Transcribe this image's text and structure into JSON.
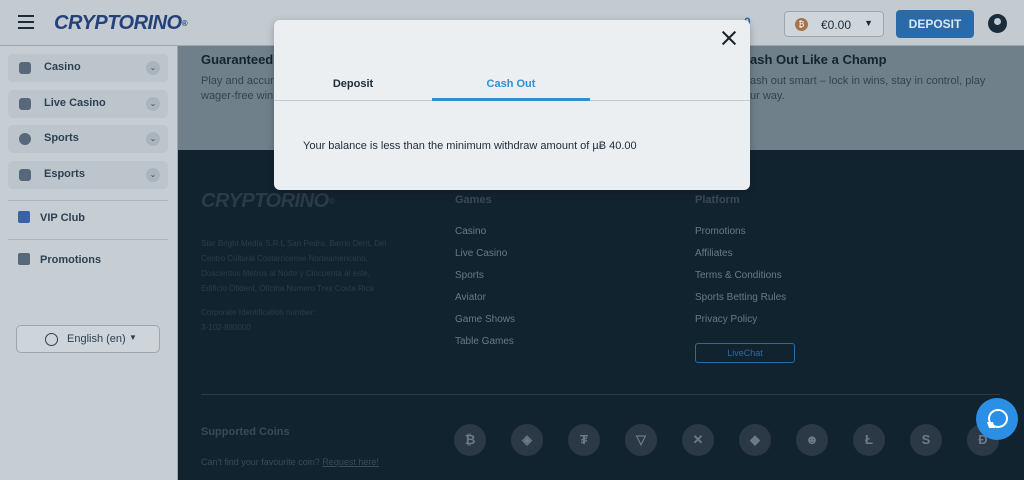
{
  "header": {
    "brand": "CRYPTORINO",
    "brand_mark": "®",
    "coins_count": "0",
    "balance": "€0.00",
    "deposit_label": "DEPOSIT"
  },
  "sidebar": {
    "items": [
      {
        "label": "Casino"
      },
      {
        "label": "Live Casino"
      },
      {
        "label": "Sports"
      },
      {
        "label": "Esports"
      }
    ],
    "vip_label": "VIP Club",
    "promotions_label": "Promotions",
    "language": "English (en)"
  },
  "promo": {
    "left_title": "Guaranteed",
    "left_line1": "Play and accum",
    "left_line2": "wager-free win",
    "right_title": "ash Out Like a Champ",
    "right_line1": "ash out smart – lock in wins, stay in control, play",
    "right_line2": "ur way."
  },
  "footer": {
    "brand": "CRYPTORINO",
    "address": "Star Bright Media S.R.L San Pedro, Barrio Dent, Del Centro Cultural Costarricense Norteamericano, Doscientos Metros al Norte y Cincuenta al este, Edificio Ofident, Oficina Numero Tres Costa Rica",
    "corp_label": "Corporate Identification number:",
    "corp_number": "3-102-880000",
    "games_title": "Games",
    "games_links": [
      "Casino",
      "Live Casino",
      "Sports",
      "Aviator",
      "Game Shows",
      "Table Games"
    ],
    "platform_title": "Platform",
    "platform_links": [
      "Promotions",
      "Affiliates",
      "Terms & Conditions",
      "Sports Betting Rules",
      "Privacy Policy"
    ],
    "livechat_label": "LiveChat",
    "coins_title": "Supported Coins",
    "coins_sub": "Can't find your favourite coin?",
    "coins_request": "Request here!",
    "coins": [
      {
        "icon": "bitcoin-icon",
        "glyph": "₿"
      },
      {
        "icon": "bnb-icon",
        "glyph": "◈"
      },
      {
        "icon": "tether-icon",
        "glyph": "₮"
      },
      {
        "icon": "tron-icon",
        "glyph": "▽"
      },
      {
        "icon": "xrp-icon",
        "glyph": "✕"
      },
      {
        "icon": "ethereum-icon",
        "glyph": "◆"
      },
      {
        "icon": "shiba-icon",
        "glyph": "☻"
      },
      {
        "icon": "litecoin-icon",
        "glyph": "Ł"
      },
      {
        "icon": "dash-icon",
        "glyph": "S"
      },
      {
        "icon": "dogecoin-icon",
        "glyph": "Đ"
      }
    ]
  },
  "modal": {
    "tab_deposit": "Deposit",
    "tab_cashout": "Cash Out",
    "message": "Your balance is less than the minimum withdraw amount of µɃ 40.00"
  }
}
